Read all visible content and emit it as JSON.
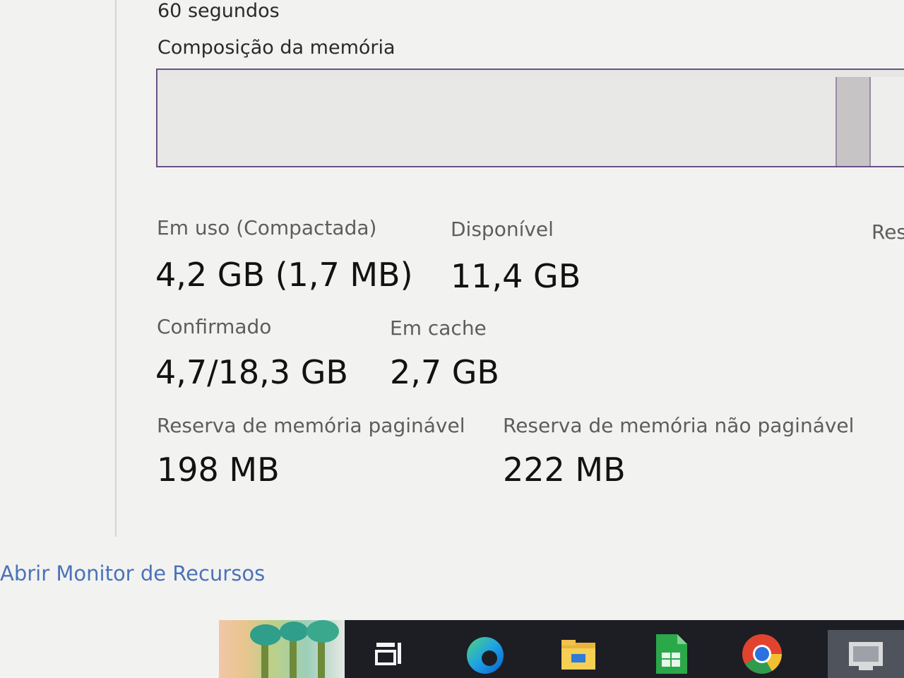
{
  "header": {
    "time_window": "60 segundos",
    "composition_label": "Composição da memória"
  },
  "stats": {
    "in_use_label": "Em uso (Compactada)",
    "in_use_value": "4,2 GB (1,7 MB)",
    "available_label": "Disponível",
    "available_value": "11,4 GB",
    "reserved_label_partial": "Res",
    "committed_label": "Confirmado",
    "committed_value": "4,7/18,3 GB",
    "cached_label": "Em cache",
    "cached_value": "2,7 GB",
    "paged_pool_label": "Reserva de memória paginável",
    "paged_pool_value": "198 MB",
    "nonpaged_pool_label": "Reserva de memória não paginável",
    "nonpaged_pool_value": "222 MB"
  },
  "footer": {
    "resource_monitor_link": "Abrir Monitor de Recursos"
  },
  "taskbar": {
    "icons": [
      "task-view-icon",
      "edge-icon",
      "file-explorer-icon",
      "libreoffice-calc-icon",
      "chrome-icon",
      "active-app-icon"
    ]
  },
  "colors": {
    "bar_border": "#6d4f86",
    "link": "#4d72b8",
    "taskbar": "#1c1e24"
  }
}
